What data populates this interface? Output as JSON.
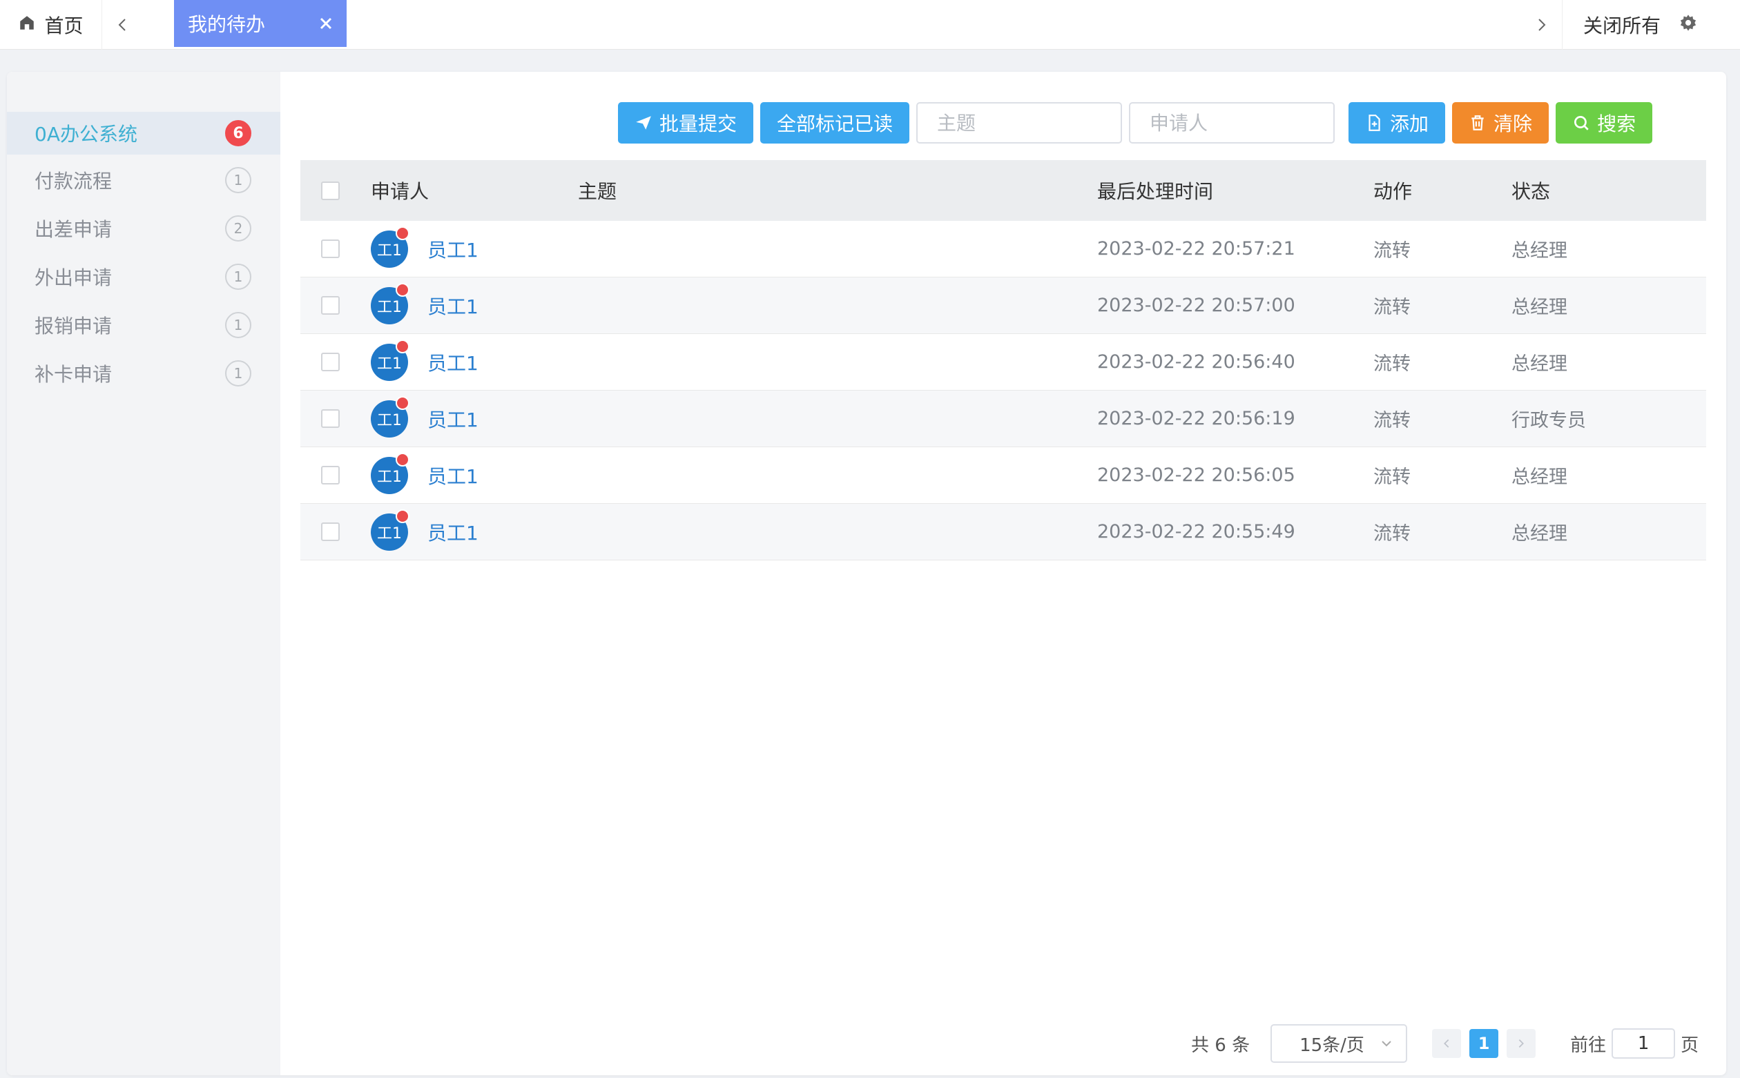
{
  "topbar": {
    "home_label": "首页",
    "active_tab_label": "我的待办",
    "close_all_label": "关闭所有"
  },
  "sidebar": {
    "items": [
      {
        "label": "0A办公系统",
        "count": "6",
        "active": true
      },
      {
        "label": "付款流程",
        "count": "1"
      },
      {
        "label": "出差申请",
        "count": "2"
      },
      {
        "label": "外出申请",
        "count": "1"
      },
      {
        "label": "报销申请",
        "count": "1"
      },
      {
        "label": "补卡申请",
        "count": "1"
      }
    ]
  },
  "toolbar": {
    "batch_submit_label": "批量提交",
    "mark_all_read_label": "全部标记已读",
    "subject_placeholder": "主题",
    "applicant_placeholder": "申请人",
    "add_label": "添加",
    "clear_label": "清除",
    "search_label": "搜索"
  },
  "table": {
    "headers": {
      "applicant": "申请人",
      "subject": "主题",
      "last_time": "最后处理时间",
      "action": "动作",
      "status": "状态"
    },
    "rows": [
      {
        "avatar": "工1",
        "applicant": "员工1",
        "subject": "",
        "time": "2023-02-22 20:57:21",
        "action": "流转",
        "status": "总经理"
      },
      {
        "avatar": "工1",
        "applicant": "员工1",
        "subject": "",
        "time": "2023-02-22 20:57:00",
        "action": "流转",
        "status": "总经理"
      },
      {
        "avatar": "工1",
        "applicant": "员工1",
        "subject": "",
        "time": "2023-02-22 20:56:40",
        "action": "流转",
        "status": "总经理"
      },
      {
        "avatar": "工1",
        "applicant": "员工1",
        "subject": "",
        "time": "2023-02-22 20:56:19",
        "action": "流转",
        "status": "行政专员"
      },
      {
        "avatar": "工1",
        "applicant": "员工1",
        "subject": "",
        "time": "2023-02-22 20:56:05",
        "action": "流转",
        "status": "总经理"
      },
      {
        "avatar": "工1",
        "applicant": "员工1",
        "subject": "",
        "time": "2023-02-22 20:55:49",
        "action": "流转",
        "status": "总经理"
      }
    ]
  },
  "pagination": {
    "total_text": "共 6 条",
    "page_size": "15条/页",
    "current_page": "1",
    "goto_label": "前往",
    "goto_value": "1",
    "page_suffix": "页"
  },
  "colors": {
    "accent": "#3ba8f0",
    "active_tab": "#6f8ff4",
    "clear_button": "#f28a2b",
    "search_button": "#6ccf46",
    "badge_red": "#f04a4e"
  }
}
